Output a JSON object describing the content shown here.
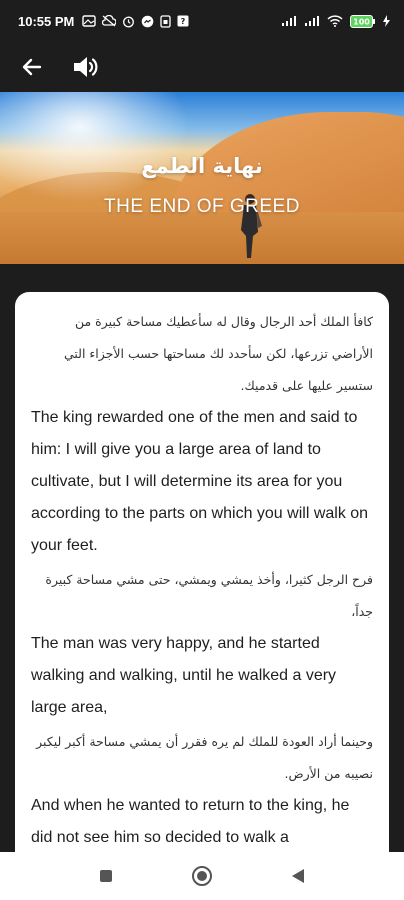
{
  "status_bar": {
    "time": "10:55 PM",
    "left_icons": [
      "photo-icon",
      "cloud-off-icon",
      "alarm-icon",
      "messenger-icon",
      "sim-icon",
      "mail-icon"
    ],
    "right_icons": [
      "signal-icon",
      "signal-icon",
      "wifi-icon",
      "battery-icon",
      "charging-icon"
    ],
    "battery_label": "100"
  },
  "app_bar": {
    "back_icon": "arrow-left-icon",
    "speaker_icon": "speaker-icon"
  },
  "banner": {
    "title_ar": "نهاية الطمع",
    "title_en": "THE END OF GREED"
  },
  "story": {
    "paragraphs": [
      {
        "ar": "كافأ الملك أحد الرجال وقال له سأعطيك مساحة كبيرة من الأراضي تزرعها، لكن سأحدد لك مساحتها حسب الأجزاء التي ستسير عليها على قدميك.",
        "en": "The king rewarded one of the men and said to him: I will give you a large area of land to cultivate, but I will determine its area for you according to the parts on which you will walk on your feet."
      },
      {
        "ar": "فرح الرجل كثيرا، وأخذ يمشي ويمشي، حتى مشي مساحة كبيرة جداً،",
        "en": "The man was very happy, and he started walking and walking, until he walked a very large area,"
      },
      {
        "ar": "وحينما أراد العودة للملك لم يره فقرر أن يمشي مساحة أكبر ليكبر نصيبه من الأرض.",
        "en": "And when he wanted to return to the king, he did not see him so decided to walk a"
      }
    ]
  },
  "nav_bar": {
    "icons": [
      "recents-square-icon",
      "home-circle-icon",
      "back-triangle-icon"
    ]
  },
  "colors": {
    "bar_bg": "#1d1d1d",
    "card_bg": "#ffffff",
    "text": "#1f1f1f"
  }
}
